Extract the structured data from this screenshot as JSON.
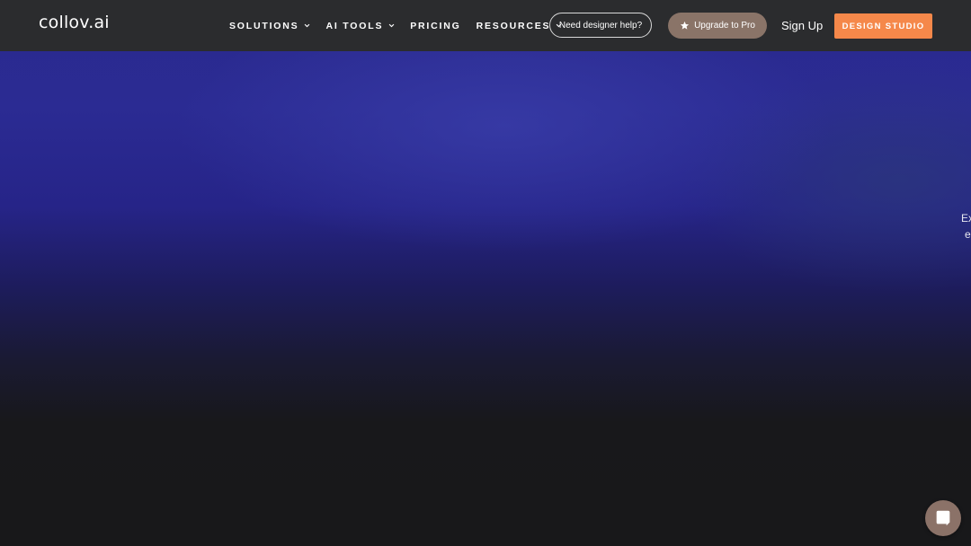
{
  "header": {
    "logo": "collov.ai",
    "nav": [
      {
        "label": "SOLUTIONS",
        "has_dropdown": true
      },
      {
        "label": "AI TOOLS",
        "has_dropdown": true
      },
      {
        "label": "PRICING",
        "has_dropdown": false
      },
      {
        "label": "RESOURCES",
        "has_dropdown": true
      }
    ],
    "help_button": "Need designer help?",
    "pro_button": "Upgrade to Pro",
    "signup": "Sign Up",
    "studio_button": "DESIGN STUDIO"
  },
  "hero": {
    "side_text_line1": "Ex",
    "side_text_line2": "e"
  },
  "colors": {
    "header_bg": "#2b2c2e",
    "accent_orange": "#f5884a",
    "pro_brown": "#8a7468",
    "hero_blue": "#2b2b93",
    "page_dark": "#18181a"
  },
  "icons": {
    "chevron": "chevron-down-icon",
    "star": "star-icon",
    "chat": "chat-bubble-icon"
  }
}
